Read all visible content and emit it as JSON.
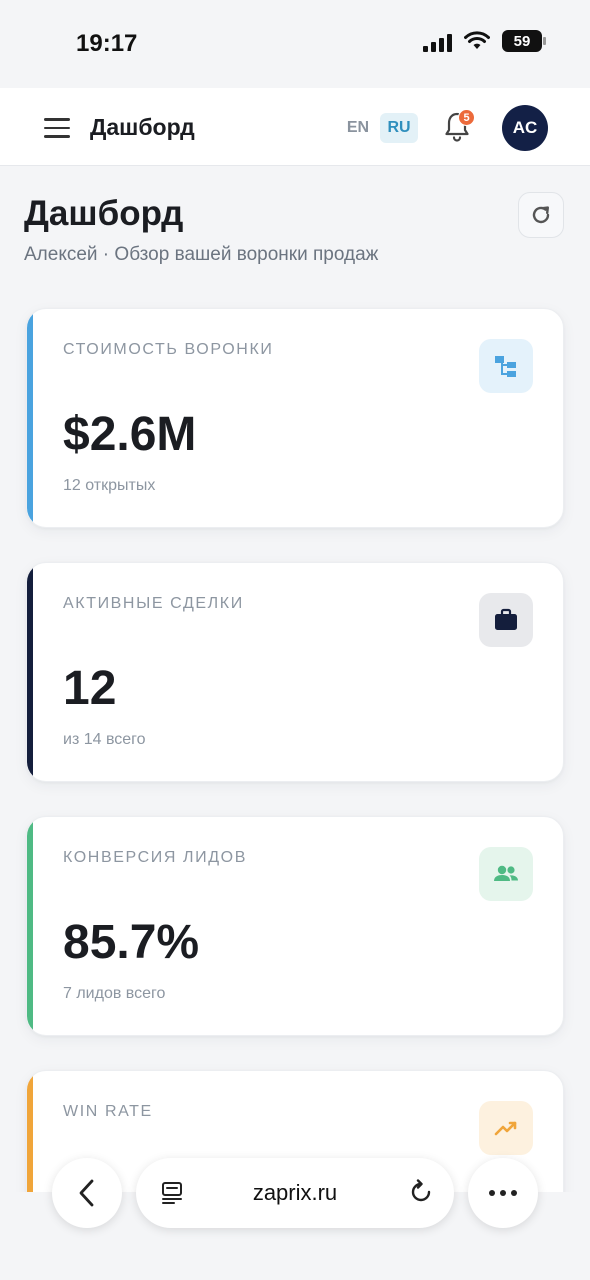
{
  "status_bar": {
    "time": "19:17",
    "battery": "59"
  },
  "header": {
    "title": "Дашборд",
    "lang_en": "EN",
    "lang_ru": "RU",
    "notifications_count": "5",
    "avatar_initials": "AC"
  },
  "page": {
    "title": "Дашборд",
    "subtitle": "Алексей · Обзор вашей воронки продаж"
  },
  "cards": [
    {
      "label": "СТОИМОСТЬ ВОРОНКИ",
      "value": "$2.6M",
      "sub": "12 открытых",
      "accent": "#4aa3df",
      "icon": "hierarchy-icon",
      "icon_bg": "#e4f2fb",
      "icon_color": "#4aa3df"
    },
    {
      "label": "АКТИВНЫЕ СДЕЛКИ",
      "value": "12",
      "sub": "из 14 всего",
      "accent": "#141e3c",
      "icon": "briefcase-icon",
      "icon_bg": "#e8e9ec",
      "icon_color": "#141e3c"
    },
    {
      "label": "КОНВЕРСИЯ ЛИДОВ",
      "value": "85.7%",
      "sub": "7 лидов всего",
      "accent": "#4fba84",
      "icon": "people-icon",
      "icon_bg": "#e5f5ec",
      "icon_color": "#4fba84"
    },
    {
      "label": "WIN RATE",
      "value": "",
      "sub": "",
      "accent": "#f0a53a",
      "icon": "trending-up-icon",
      "icon_bg": "#fdf1df",
      "icon_color": "#f0a53a"
    }
  ],
  "browser": {
    "url": "zaprix.ru"
  }
}
